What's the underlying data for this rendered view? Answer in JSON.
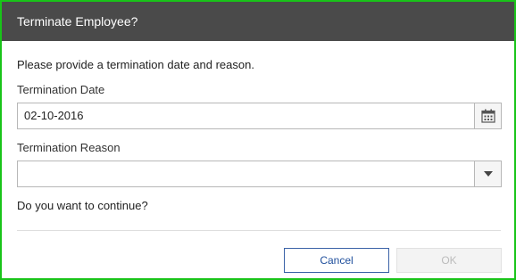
{
  "dialog": {
    "title": "Terminate Employee?",
    "intro": "Please provide a termination date and reason.",
    "date_label": "Termination Date",
    "date_value": "02-10-2016",
    "reason_label": "Termination Reason",
    "reason_value": "",
    "question": "Do you want to continue?",
    "cancel_label": "Cancel",
    "ok_label": "OK"
  },
  "icons": {
    "calendar": "calendar-icon",
    "dropdown": "caret-down-icon"
  },
  "colors": {
    "header_bg": "#4a4a4a",
    "frame_border": "#19c419",
    "cancel_text": "#1f4f9c",
    "disabled_text": "#bcbcbc"
  }
}
